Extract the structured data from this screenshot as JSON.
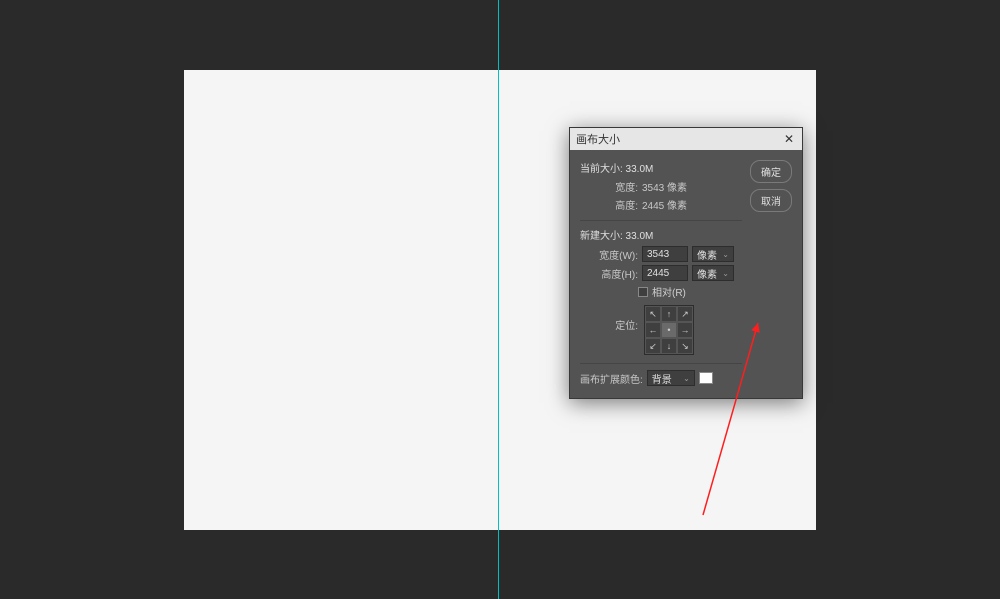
{
  "dialog": {
    "title": "画布大小",
    "closeLabel": "✕",
    "ok": "确定",
    "cancel": "取消",
    "currentSize": {
      "header": "当前大小: 33.0M",
      "widthLabel": "宽度:",
      "widthValue": "3543 像素",
      "heightLabel": "高度:",
      "heightValue": "2445 像素"
    },
    "newSize": {
      "header": "新建大小: 33.0M",
      "widthLabel": "宽度(W):",
      "widthValue": "3543",
      "widthUnit": "像素",
      "heightLabel": "高度(H):",
      "heightValue": "2445",
      "heightUnit": "像素",
      "relativeLabel": "相对(R)",
      "anchorLabel": "定位:"
    },
    "extension": {
      "label": "画布扩展颜色:",
      "value": "背景",
      "swatchColor": "#ffffff"
    }
  },
  "arrows": {
    "nw": "↖",
    "n": "↑",
    "ne": "↗",
    "w": "←",
    "c": "•",
    "e": "→",
    "sw": "↙",
    "s": "↓",
    "se": "↘"
  }
}
